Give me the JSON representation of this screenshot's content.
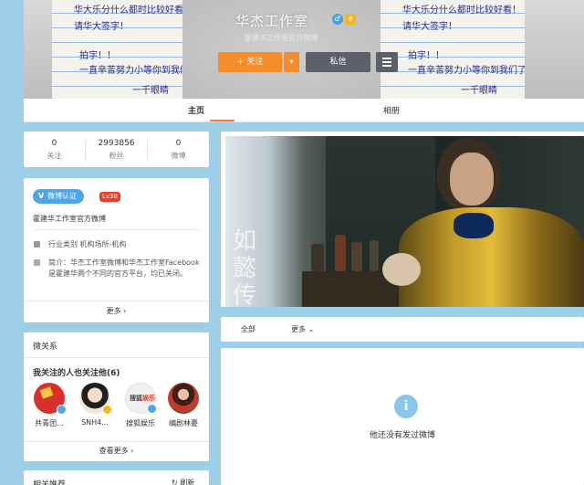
{
  "header": {
    "name": "华杰工作室",
    "subline": "霍建华工作室官方微博",
    "follow_label": "+ 关注",
    "more_caret": "▾",
    "message_label": "私信",
    "menu_icon": "menu-icon",
    "gender_icon": "male-icon",
    "gender_glyph": "♂",
    "vip_icon": "vip-crown-icon",
    "note_lines": [
      "华大乐分什么都时比较好看！",
      "请华大签字！",
      "拍字！！",
      "一直辛苦努力小等你到我们了一份",
      "一千眼睛"
    ]
  },
  "nav": {
    "tabs": [
      {
        "label": "主页",
        "active": true
      },
      {
        "label": "相册",
        "active": false
      }
    ],
    "accent": "#fa7d3c"
  },
  "stats": [
    {
      "value": "0",
      "label": "关注"
    },
    {
      "value": "2993856",
      "label": "粉丝"
    },
    {
      "value": "0",
      "label": "微博"
    }
  ],
  "info": {
    "verify_label": "微博认证",
    "verify_glyph": "V",
    "level": "Lv38",
    "verify_text": "霍建华工作室官方微博",
    "industry": "行业类别 机构场所-机构",
    "intro": "简介：华杰工作室微博和华杰工作室Facebook是霍建华两个不同的官方平台，均已关闭。",
    "more_label": "更多 ›"
  },
  "relations": {
    "title": "微关系",
    "subtitle": "我关注的人也关注他(6)",
    "friends": [
      {
        "name": "共青团...",
        "color": "#d8302a",
        "badge": "#4fa6e6"
      },
      {
        "name": "SNH4...",
        "color": "#f1e6dc",
        "badge": "#f5b521"
      },
      {
        "name": "搜狐娱乐",
        "color": "#f0f0f0",
        "badge": "#4fa6e6"
      },
      {
        "name": "编剧林憂",
        "color": "#7b4a3a",
        "badge": "#ffffff"
      }
    ],
    "view_more": "查看更多 ›"
  },
  "recommend": {
    "title": "相关推荐",
    "refresh": "↻ 刷新"
  },
  "feed": {
    "photo_caption": "如懿传",
    "filter_all": "全部",
    "filter_more": "更多 ⌄",
    "empty_icon": "i",
    "empty_text": "他还没有发过微博"
  }
}
